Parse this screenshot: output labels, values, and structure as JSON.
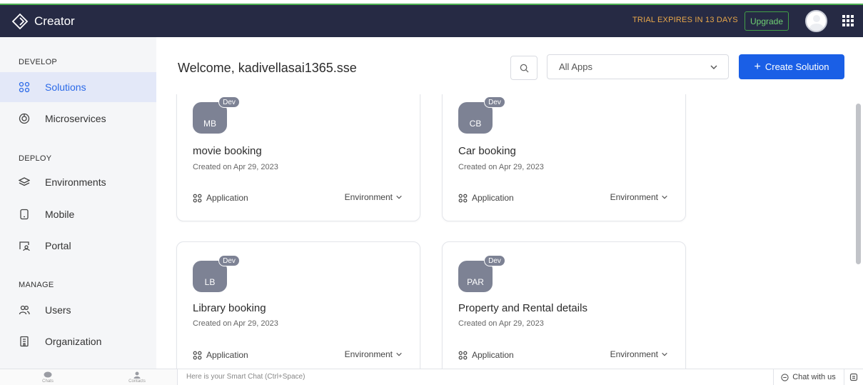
{
  "header": {
    "app_name": "Creator",
    "trial_text": "TRIAL EXPIRES IN 13 DAYS",
    "upgrade_label": "Upgrade"
  },
  "sidebar": {
    "sections": [
      {
        "label": "DEVELOP",
        "items": [
          {
            "label": "Solutions",
            "icon": "apps-grid-icon",
            "active": true
          },
          {
            "label": "Microservices",
            "icon": "microservices-icon"
          }
        ]
      },
      {
        "label": "DEPLOY",
        "items": [
          {
            "label": "Environments",
            "icon": "layers-icon"
          },
          {
            "label": "Mobile",
            "icon": "mobile-icon"
          },
          {
            "label": "Portal",
            "icon": "portal-icon"
          }
        ]
      },
      {
        "label": "MANAGE",
        "items": [
          {
            "label": "Users",
            "icon": "users-icon"
          },
          {
            "label": "Organization",
            "icon": "organization-icon"
          }
        ]
      }
    ]
  },
  "main": {
    "welcome": "Welcome, kadivellasai1365.sse",
    "filter_value": "All Apps",
    "create_label": "Create Solution",
    "cards": [
      {
        "initials": "MB",
        "badge": "Dev",
        "title": "movie booking",
        "date": "Created on Apr 29, 2023",
        "type": "Application",
        "env": "Environment"
      },
      {
        "initials": "CB",
        "badge": "Dev",
        "title": "Car booking",
        "date": "Created on Apr 29, 2023",
        "type": "Application",
        "env": "Environment"
      },
      {
        "initials": "LB",
        "badge": "Dev",
        "title": "Library booking",
        "date": "Created on Apr 29, 2023",
        "type": "Application",
        "env": "Environment"
      },
      {
        "initials": "PAR",
        "badge": "Dev",
        "title": "Property and Rental details",
        "date": "Created on Apr 29, 2023",
        "type": "Application",
        "env": "Environment"
      }
    ]
  },
  "bottombar": {
    "smart_chat": "Here is your Smart Chat (Ctrl+Space)",
    "chat_with_us": "Chat with us",
    "left_icons": [
      "Chats",
      "Contacts"
    ]
  },
  "colors": {
    "header_bg": "#262a44",
    "accent": "#1a5fe6",
    "trial": "#e8a74a",
    "badge": "#7d8294"
  }
}
